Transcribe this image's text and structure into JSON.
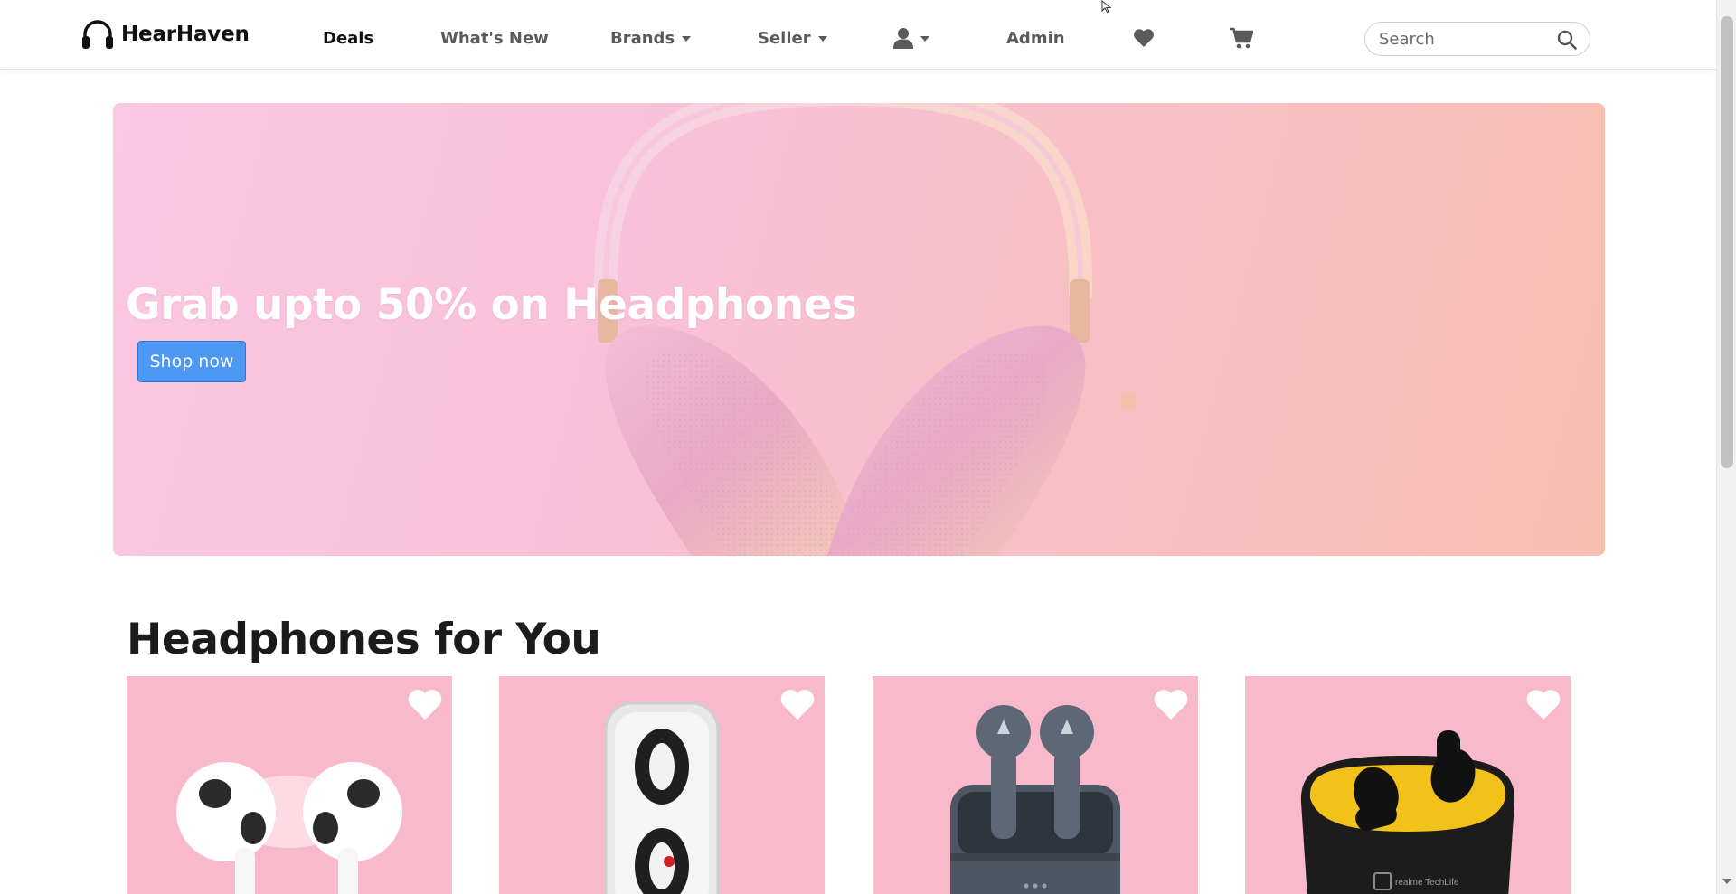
{
  "navbar": {
    "brand": "HearHaven",
    "links": {
      "deals": "Deals",
      "whats_new": "What's New",
      "brands": "Brands",
      "seller": "Seller",
      "admin": "Admin"
    },
    "search_placeholder": "Search",
    "icons": [
      "headphones-icon",
      "user-icon",
      "heart-icon",
      "cart-icon",
      "search-icon"
    ]
  },
  "hero": {
    "title": "Grab upto 50% on Headphones",
    "button": "Shop now"
  },
  "section": {
    "title": "Headphones for You",
    "products": [
      {
        "id": "product-1",
        "image": "white-earbuds"
      },
      {
        "id": "product-2",
        "image": "transparent-earbuds"
      },
      {
        "id": "product-3",
        "image": "grey-earbuds-case"
      },
      {
        "id": "product-4",
        "image": "black-yellow-earbuds-case",
        "case_text": "realme TechLife"
      }
    ]
  },
  "colors": {
    "accent_button": "#4d97f5",
    "card_bg": "#f8bacb",
    "hero_bg": "#f9c1d9"
  }
}
